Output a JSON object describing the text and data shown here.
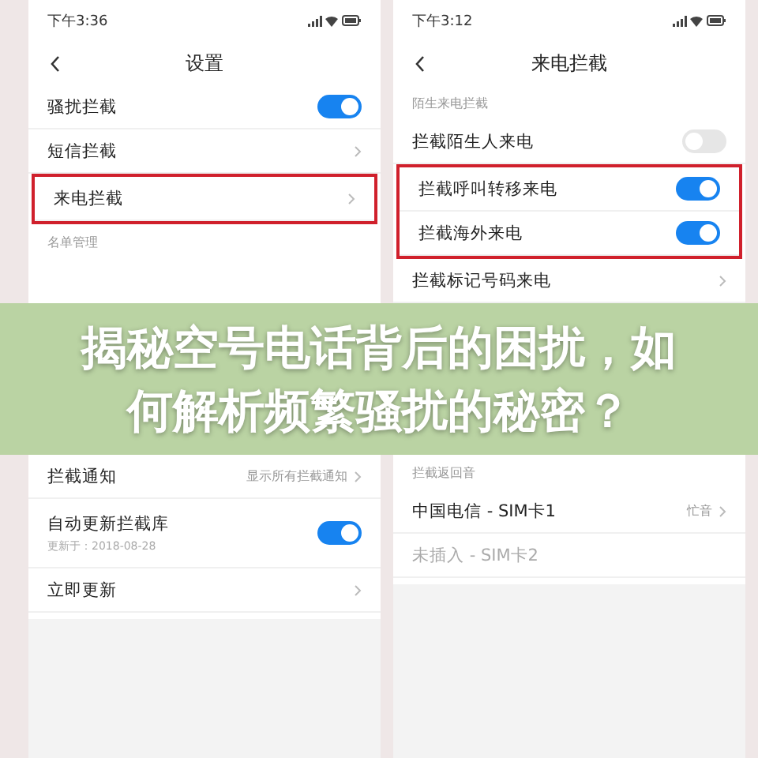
{
  "phones": [
    {
      "time": "下午3:36",
      "title": "设置",
      "rows_top": [
        {
          "kind": "toggle",
          "label": "骚扰拦截",
          "on": true
        },
        {
          "kind": "link",
          "label": "短信拦截"
        },
        {
          "kind": "boxed",
          "items": [
            {
              "kind": "link",
              "label": "来电拦截"
            }
          ]
        },
        {
          "kind": "section",
          "label": "名单管理"
        }
      ],
      "rows_bottom": [
        {
          "kind": "link",
          "label": "拦截通知",
          "value": "显示所有拦截通知"
        },
        {
          "kind": "toggle",
          "label": "自动更新拦截库",
          "subtitle": "更新于：2018-08-28",
          "on": true
        },
        {
          "kind": "link",
          "label": "立即更新"
        }
      ]
    },
    {
      "time": "下午3:12",
      "title": "来电拦截",
      "rows_top": [
        {
          "kind": "section",
          "label": "陌生来电拦截"
        },
        {
          "kind": "toggle",
          "label": "拦截陌生人来电",
          "on": false
        },
        {
          "kind": "boxed",
          "items": [
            {
              "kind": "toggle",
              "label": "拦截呼叫转移来电",
              "on": true
            },
            {
              "kind": "toggle",
              "label": "拦截海外来电",
              "on": true
            }
          ]
        },
        {
          "kind": "link",
          "label": "拦截标记号码来电"
        }
      ],
      "rows_bottom": [
        {
          "kind": "section",
          "label": "拦截返回音"
        },
        {
          "kind": "link",
          "label": "中国电信 - SIM卡1",
          "value": "忙音"
        },
        {
          "kind": "text",
          "label": "未插入 - SIM卡2",
          "disabled": true
        }
      ]
    }
  ],
  "banner": {
    "lines": [
      "揭秘空号电话背后的困扰，如",
      "何解析频繁骚扰的秘密？"
    ]
  }
}
